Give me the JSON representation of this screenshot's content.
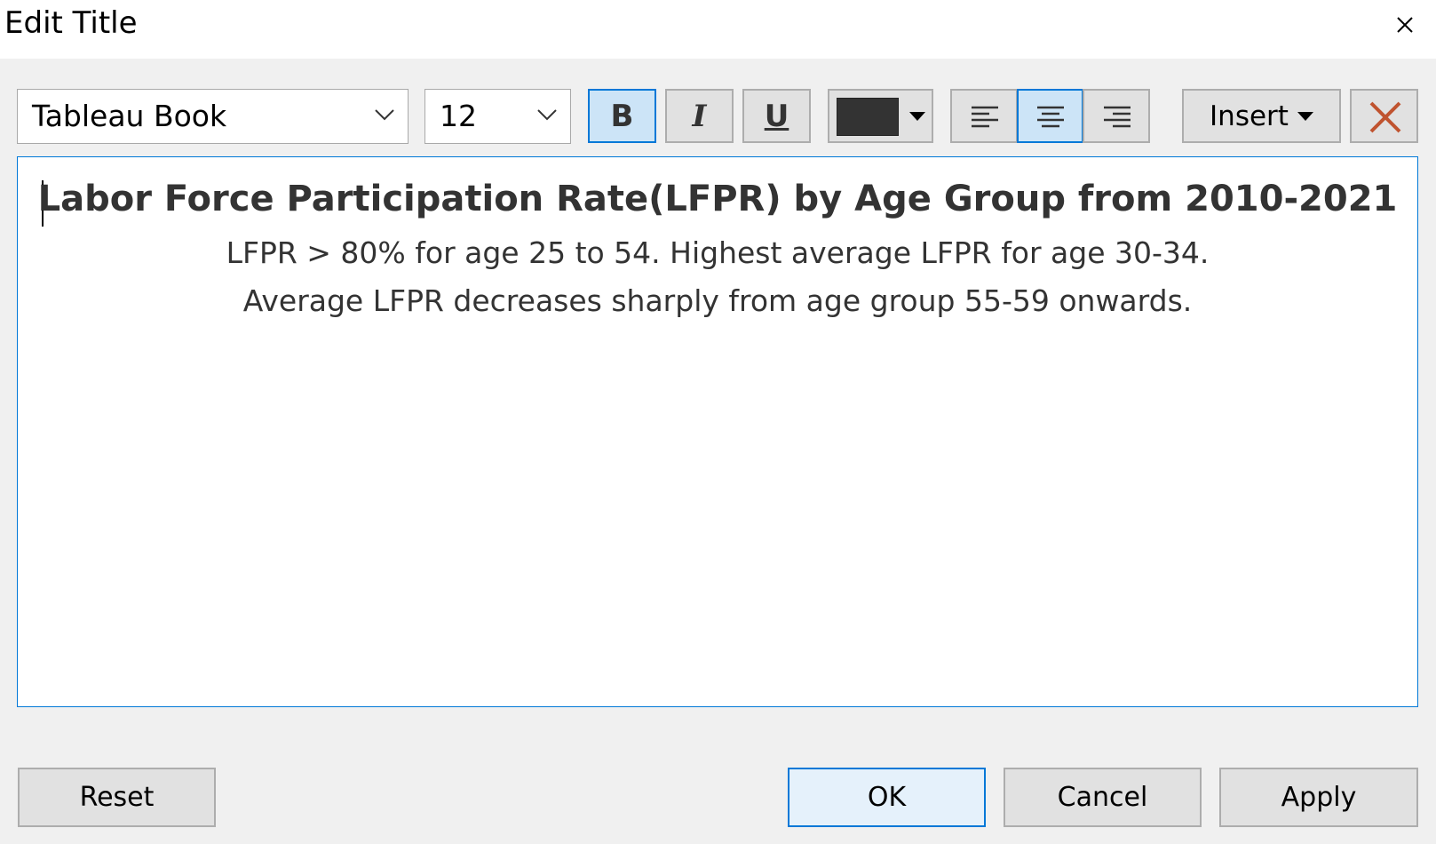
{
  "dialog": {
    "title": "Edit Title"
  },
  "toolbar": {
    "font_family": "Tableau Book",
    "font_size": "12",
    "bold": "B",
    "italic": "I",
    "underline": "U",
    "bold_active": true,
    "text_color": "#333333",
    "alignment_selected": "center",
    "insert_label": "Insert",
    "clear_color": "#c0532f"
  },
  "editor": {
    "line1": "Labor Force Participation Rate(LFPR) by Age Group from 2010-2021",
    "line2": "LFPR > 80% for age 25 to 54. Highest average LFPR for age 30-34.",
    "line3": "Average LFPR decreases  sharply from age group 55-59 onwards."
  },
  "footer": {
    "reset": "Reset",
    "ok": "OK",
    "cancel": "Cancel",
    "apply": "Apply"
  },
  "colors": {
    "accent": "#0078d7",
    "active_bg": "#cce4f7"
  }
}
